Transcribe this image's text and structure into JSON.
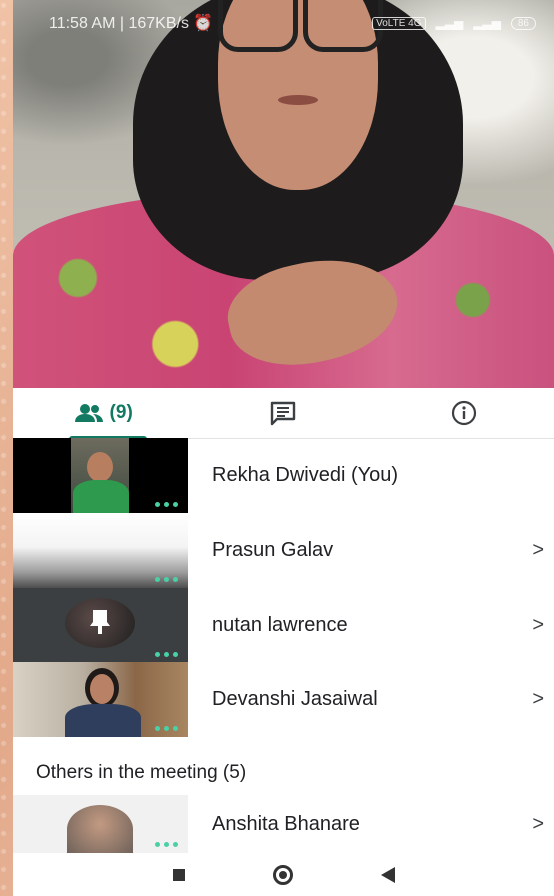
{
  "status_bar": {
    "time_speed": "11:58 AM | 167KB/s",
    "network": "VoLTE 4G",
    "battery": "86"
  },
  "tabs": {
    "people_count": "(9)",
    "active": "people"
  },
  "participants": [
    {
      "name": "Rekha Dwivedi (You)",
      "has_chevron": false
    },
    {
      "name": "Prasun Galav",
      "has_chevron": true
    },
    {
      "name": "nutan lawrence",
      "has_chevron": true
    },
    {
      "name": "Devanshi Jasaiwal",
      "has_chevron": true
    }
  ],
  "others_section": {
    "title": "Others in the meeting (5)",
    "items": [
      {
        "name": "Anshita Bhanare",
        "has_chevron": true
      }
    ]
  },
  "chevron": ">",
  "colors": {
    "accent": "#137a62",
    "dots": "#49d1a5"
  },
  "icons": [
    "people-icon",
    "chat-icon",
    "info-icon",
    "more-dots-icon",
    "chevron-right-icon",
    "bell-icon",
    "nav-square-icon",
    "nav-circle-icon",
    "nav-back-icon"
  ]
}
